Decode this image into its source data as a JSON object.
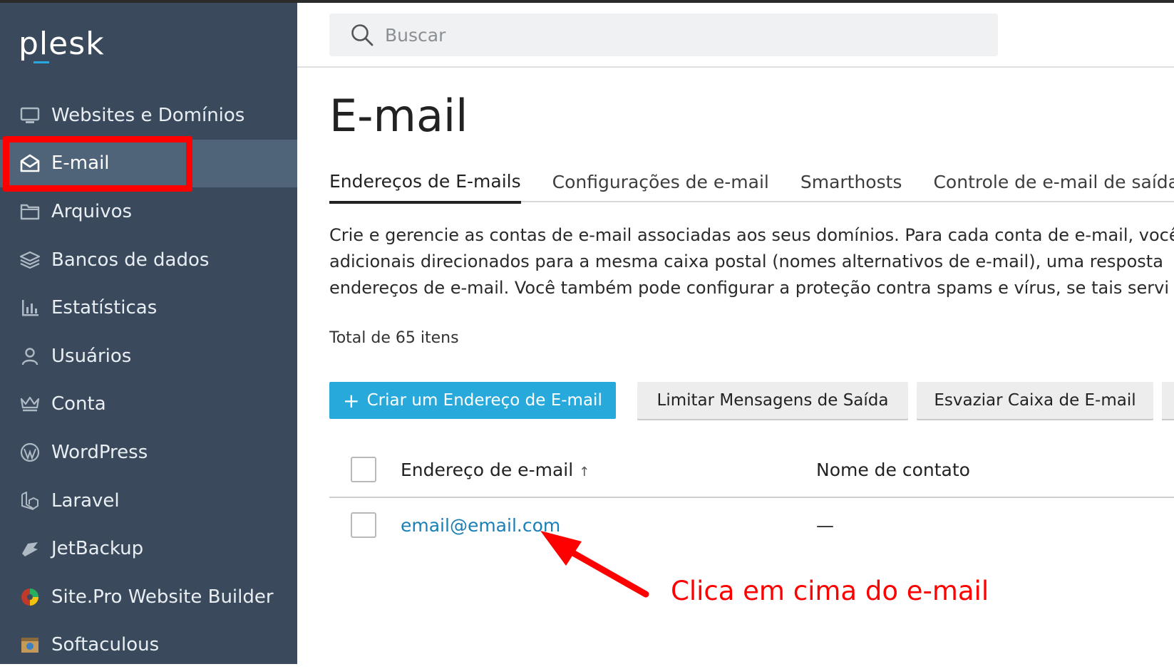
{
  "brand": {
    "logo": "plesk"
  },
  "sidebar": {
    "items": [
      {
        "label": "Websites e Domínios",
        "icon": "monitor-icon"
      },
      {
        "label": "E-mail",
        "icon": "envelope-icon",
        "active": true
      },
      {
        "label": "Arquivos",
        "icon": "folder-icon"
      },
      {
        "label": "Bancos de dados",
        "icon": "database-layers-icon"
      },
      {
        "label": "Estatísticas",
        "icon": "bar-chart-icon"
      },
      {
        "label": "Usuários",
        "icon": "user-icon"
      },
      {
        "label": "Conta",
        "icon": "crown-icon"
      },
      {
        "label": "WordPress",
        "icon": "wordpress-icon"
      },
      {
        "label": "Laravel",
        "icon": "laravel-icon"
      },
      {
        "label": "JetBackup",
        "icon": "jetbackup-icon"
      },
      {
        "label": "Site.Pro Website Builder",
        "icon": "sitepro-icon"
      },
      {
        "label": "Softaculous",
        "icon": "softaculous-icon"
      }
    ]
  },
  "search": {
    "placeholder": "Buscar"
  },
  "page": {
    "title": "E-mail",
    "tabs": [
      {
        "label": "Endereços de E-mails",
        "active": true
      },
      {
        "label": "Configurações de e-mail"
      },
      {
        "label": "Smarthosts"
      },
      {
        "label": "Controle de e-mail de saída"
      }
    ],
    "description_lines": [
      "Crie e gerencie as contas de e-mail associadas aos seus domínios. Para cada conta de e-mail, você",
      "adicionais direcionados para a mesma caixa postal (nomes alternativos de e-mail), uma resposta",
      "endereços de e-mail. Você também pode configurar a proteção contra spams e vírus, se tais servi"
    ],
    "total": "Total de 65 itens"
  },
  "toolbar": {
    "create_label": "Criar um Endereço de E-mail",
    "create_plus": "+",
    "limit_label": "Limitar Mensagens de Saída",
    "empty_label": "Esvaziar Caixa de E-mail"
  },
  "table": {
    "columns": {
      "email": "Endereço de e-mail",
      "sort": "↑",
      "contact": "Nome de contato"
    },
    "rows": [
      {
        "email": "email@email.com",
        "contact": "—"
      }
    ]
  },
  "annotation": {
    "text": "Clica em cima do e-mail",
    "color": "#ff0000"
  },
  "colors": {
    "sidebar": "#3a4a5c",
    "sidebar_active": "#4f6478",
    "primary": "#28a9dc",
    "link": "#1a7fb5"
  }
}
